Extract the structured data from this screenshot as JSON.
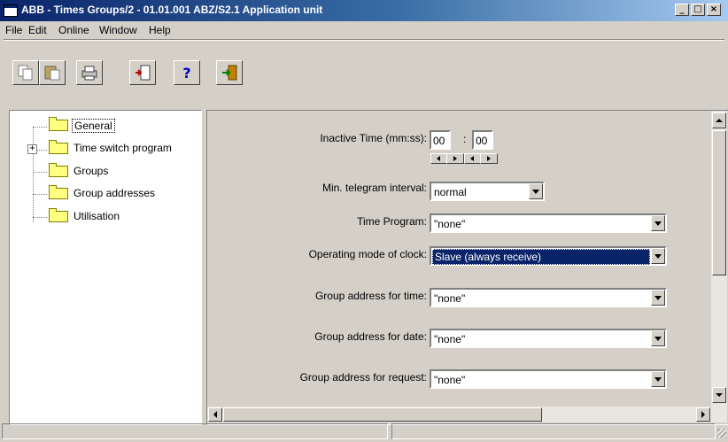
{
  "window": {
    "title": "ABB - Times Groups/2 - 01.01.001 ABZ/S2.1 Application unit",
    "buttons": {
      "minimize": "_",
      "restore": "□",
      "close": "×"
    }
  },
  "menu": [
    "File",
    "Edit",
    "Online",
    "Window",
    "Help"
  ],
  "toolbar": {
    "buttons": [
      {
        "name": "copy-icon"
      },
      {
        "name": "paste-icon"
      },
      {
        "name": "print-icon"
      },
      {
        "name": "import-icon"
      },
      {
        "name": "help-icon",
        "glyph": "?"
      },
      {
        "name": "exit-icon"
      }
    ]
  },
  "tree": {
    "items": [
      {
        "label": "General",
        "selected": true
      },
      {
        "label": "Time switch program",
        "expandable": true
      },
      {
        "label": "Groups"
      },
      {
        "label": "Group addresses"
      },
      {
        "label": "Utilisation"
      }
    ],
    "expander": "+"
  },
  "form": {
    "inactive_time": {
      "label": "Inactive Time (mm:ss):",
      "minutes": "00",
      "separator": ":",
      "seconds": "00"
    },
    "min_telegram": {
      "label": "Min. telegram interval:",
      "value": "normal"
    },
    "time_program": {
      "label": "Time Program:",
      "value": "\"none\""
    },
    "operating_mode": {
      "label": "Operating mode of clock:",
      "value": "Slave (always receive)"
    },
    "group_time": {
      "label": "Group address for time:",
      "value": "\"none\""
    },
    "group_date": {
      "label": "Group address for date:",
      "value": "\"none\""
    },
    "group_request": {
      "label": "Group address for request:",
      "value": "\"none\""
    }
  },
  "colors": {
    "titlebar": "#0a246a",
    "selection": "#0a246a",
    "face": "#d4d0c8",
    "folder": "#ffff80"
  }
}
